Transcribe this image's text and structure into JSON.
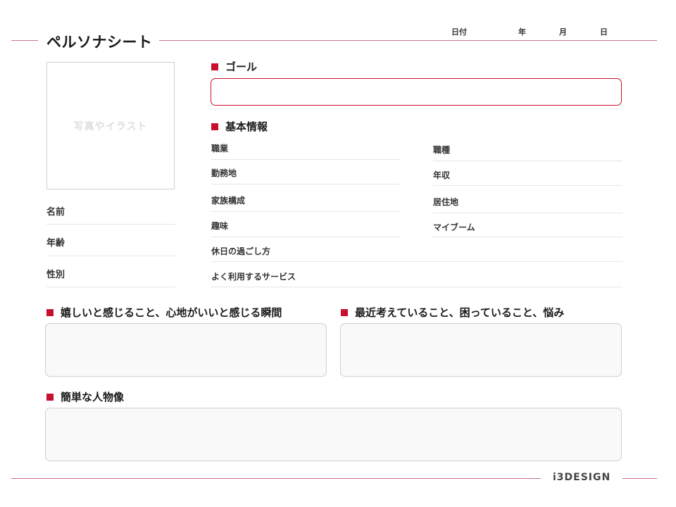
{
  "header": {
    "title": "ペルソナシート",
    "date_label": "日付",
    "year_label": "年",
    "month_label": "月",
    "day_label": "日"
  },
  "photo": {
    "placeholder": "写真やイラスト"
  },
  "profile": {
    "name_label": "名前",
    "age_label": "年齢",
    "gender_label": "性別"
  },
  "goal": {
    "heading": "ゴール"
  },
  "basic_info": {
    "heading": "基本情報",
    "left_fields": [
      "職業",
      "勤務地",
      "家族構成",
      "趣味",
      "休日の過ごし方",
      "よく利用するサービス"
    ],
    "right_fields": [
      "職種",
      "年収",
      "居住地",
      "マイブーム"
    ]
  },
  "sections": {
    "happy": "嬉しいと感じること、心地がいいと感じる瞬間",
    "worries": "最近考えていること、困っていること、悩み",
    "persona": "簡単な人物像"
  },
  "footer": {
    "brand": "i3DESIGN"
  },
  "colors": {
    "accent": "#c8102e",
    "rule": "#cf6f86"
  }
}
